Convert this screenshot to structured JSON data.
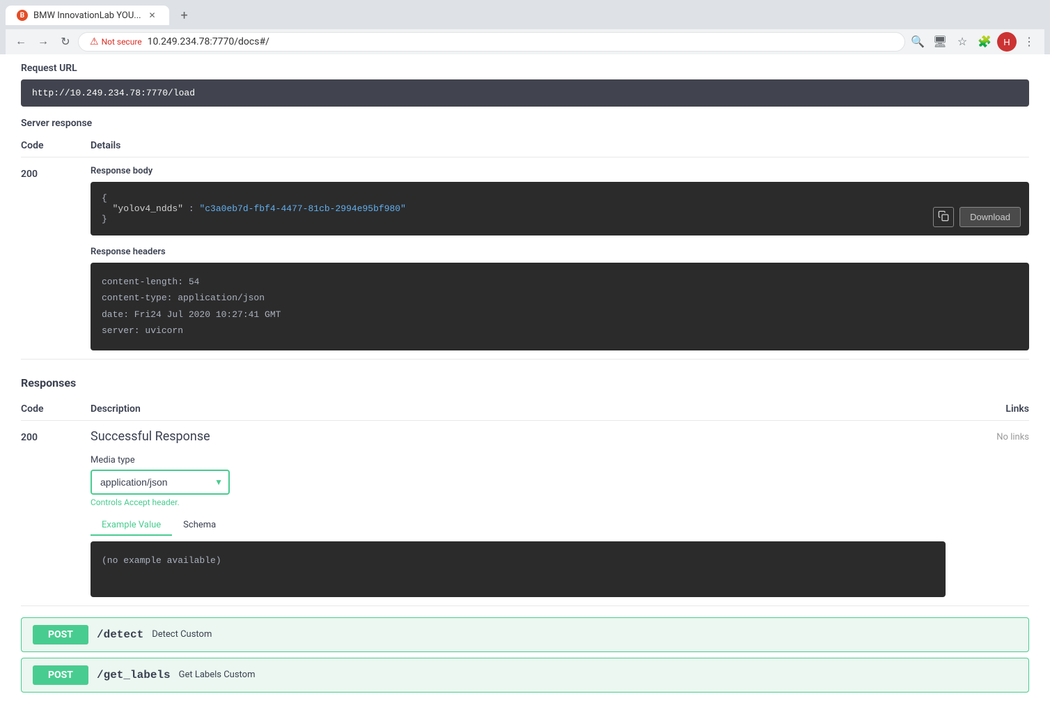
{
  "browser": {
    "tab_title": "BMW InnovationLab YOU...",
    "tab_favicon": "B",
    "url_insecure_label": "Not secure",
    "url": "10.249.234.78:7770/docs#/",
    "url_full": "http://10.249.234.78:7770/docs#/"
  },
  "request_url": {
    "label": "Request URL",
    "value": "http://10.249.234.78:7770/load"
  },
  "server_response": {
    "label": "Server response",
    "col_code": "Code",
    "col_details": "Details",
    "code": "200",
    "response_body_label": "Response body",
    "response_body_brace_open": "{",
    "response_body_key": "\"yolov4_ndds\"",
    "response_body_colon": ":",
    "response_body_value": "\"c3a0eb7d-fbf4-4477-81cb-2994e95bf980\"",
    "response_body_brace_close": "}",
    "download_label": "Download",
    "response_headers_label": "Response headers",
    "header_content_length": "content-length: 54",
    "header_content_type": "content-type: application/json",
    "header_date": "date: Fri24 Jul 2020 10:27:41 GMT",
    "header_server": "server: uvicorn"
  },
  "responses": {
    "label": "Responses",
    "col_code": "Code",
    "col_description": "Description",
    "col_links": "Links",
    "code": "200",
    "description": "Successful Response",
    "links_value": "No links",
    "media_type_label": "Media type",
    "media_type_value": "application/json",
    "controls_text": "Controls Accept header.",
    "example_value_tab": "Example Value",
    "schema_tab": "Schema",
    "example_placeholder": "(no example available)"
  },
  "endpoints": [
    {
      "method": "POST",
      "path": "/detect",
      "description": "Detect Custom"
    },
    {
      "method": "POST",
      "path": "/get_labels",
      "description": "Get Labels Custom"
    }
  ]
}
